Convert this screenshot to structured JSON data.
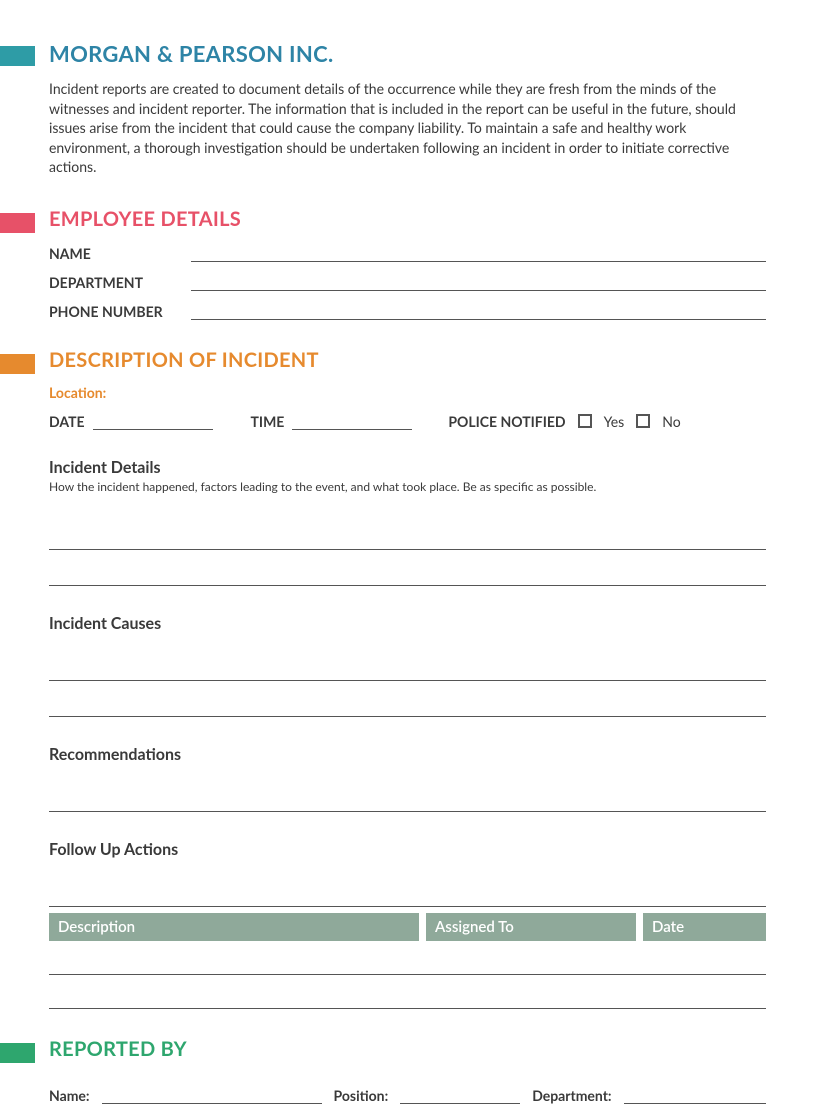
{
  "header": {
    "company": "MORGAN & PEARSON INC.",
    "intro": "Incident reports are created to document details of the occurrence while they are fresh from the minds of the witnesses and incident reporter. The information that is included in the report can be useful in the future, should issues arise from the incident that could cause the company liability. To maintain a safe and healthy work environment, a thorough investigation should be undertaken following an incident in order to initiate corrective actions."
  },
  "employee": {
    "heading": "EMPLOYEE DETAILS",
    "fields": {
      "name_label": "NAME",
      "department_label": "DEPARTMENT",
      "phone_label": "PHONE NUMBER"
    }
  },
  "incident": {
    "heading": "DESCRIPTION OF INCIDENT",
    "location_label": "Location:",
    "date_label": "DATE",
    "time_label": "TIME",
    "police_label": "POLICE NOTIFIED",
    "yes": "Yes",
    "no": "No",
    "details_heading": "Incident Details",
    "details_desc": "How the incident happened, factors leading to the event, and what took place. Be as specific as possible.",
    "causes_heading": "Incident Causes",
    "recommendations_heading": "Recommendations",
    "followup_heading": "Follow Up Actions",
    "table": {
      "description": "Description",
      "assigned": "Assigned To",
      "date": "Date"
    }
  },
  "reported": {
    "heading": "REPORTED BY",
    "name_label": "Name:",
    "position_label": "Position:",
    "department_label": "Department:"
  }
}
